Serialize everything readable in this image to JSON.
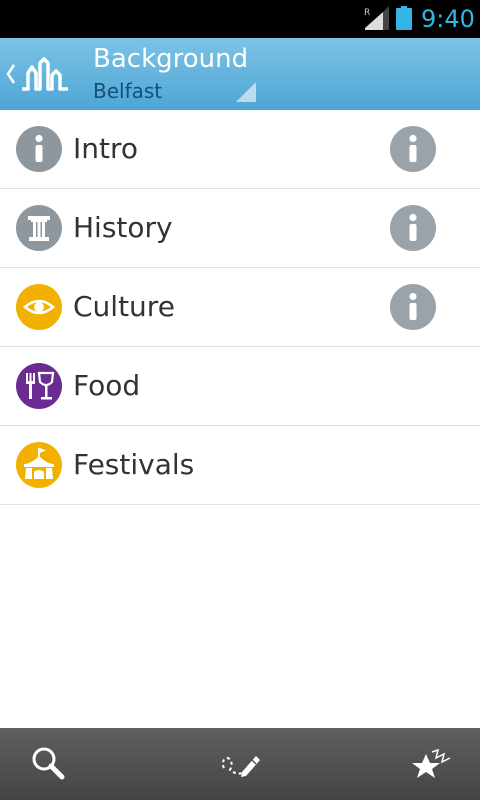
{
  "status_bar": {
    "time": "9:40",
    "roaming_indicator": "R",
    "icons": [
      "signal-icon",
      "battery-icon"
    ],
    "accent_color": "#33b5e5"
  },
  "action_bar": {
    "title": "Background",
    "subtitle": "Belfast",
    "icons": [
      "up-chevron-icon",
      "skyline-logo-icon",
      "spinner-arrow-icon"
    ],
    "background_color": "#5fb1dd"
  },
  "list": {
    "items": [
      {
        "label": "Intro",
        "icon": "info-icon",
        "icon_color": "#8e979d",
        "has_info_button": true
      },
      {
        "label": "History",
        "icon": "column-icon",
        "icon_color": "#8e979d",
        "has_info_button": true
      },
      {
        "label": "Culture",
        "icon": "eye-icon",
        "icon_color": "#f2b100",
        "has_info_button": true
      },
      {
        "label": "Food",
        "icon": "fork-and-wine-icon",
        "icon_color": "#6a2c91",
        "has_info_button": false
      },
      {
        "label": "Festivals",
        "icon": "tent-icon",
        "icon_color": "#f2b100",
        "has_info_button": false
      }
    ]
  },
  "bottom_bar": {
    "buttons": [
      "search-icon",
      "route-edit-icon",
      "favorites-icon"
    ]
  }
}
